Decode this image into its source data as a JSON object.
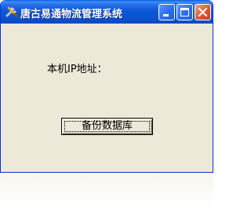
{
  "window": {
    "title": "唐古易通物流管理系统",
    "icon": "tools-icon",
    "controls": [
      "minimize-icon",
      "maximize-icon",
      "close-icon"
    ]
  },
  "form": {
    "ip_label": "本机IP地址：",
    "backup_button_label": "备份数据库"
  },
  "colors": {
    "titlebar": "#0a52d0",
    "client_background": "#ece9d8",
    "close_button": "#e0552f"
  }
}
